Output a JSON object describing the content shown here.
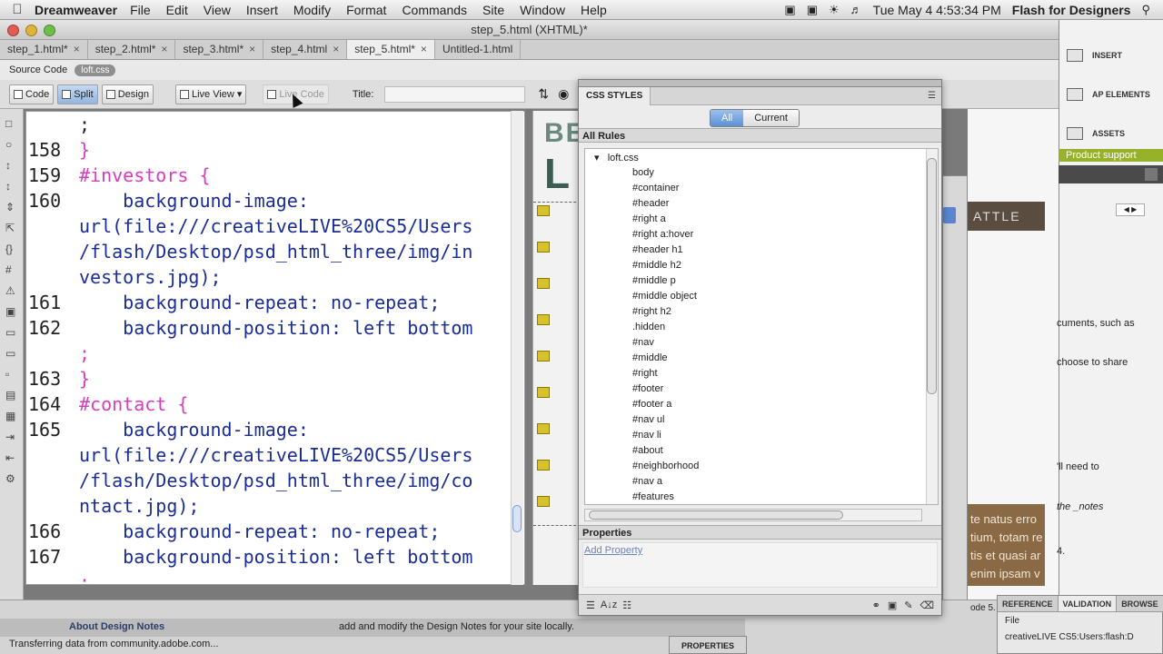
{
  "menubar": {
    "app_name": "Dreamweaver",
    "items": [
      "File",
      "Edit",
      "View",
      "Insert",
      "Modify",
      "Format",
      "Commands",
      "Site",
      "Window",
      "Help"
    ],
    "clock": "Tue May 4  4:53:34 PM",
    "workspace": "Flash for Designers"
  },
  "window": {
    "title": "step_5.html (XHTML)*",
    "tabs": [
      "step_1.html*",
      "step_2.html*",
      "step_3.html*",
      "step_4.html",
      "step_5.html*",
      "Untitled-1.html"
    ],
    "active_tab": 4
  },
  "related_files": {
    "source": "Source Code",
    "file": "loft.css"
  },
  "toolbar": {
    "code": "Code",
    "split": "Split",
    "design": "Design",
    "live_view": "Live View",
    "live_code": "Live Code",
    "title_label": "Title:"
  },
  "code": [
    {
      "num": "",
      "text": ";"
    },
    {
      "num": "158",
      "text": "}"
    },
    {
      "num": "159",
      "text": "#investors {"
    },
    {
      "num": "160",
      "text": "    background-image:"
    },
    {
      "num": "",
      "text": "url(file:///creativeLIVE%20CS5/Users"
    },
    {
      "num": "",
      "text": "/flash/Desktop/psd_html_three/img/in"
    },
    {
      "num": "",
      "text": "vestors.jpg);"
    },
    {
      "num": "161",
      "text": "    background-repeat: no-repeat;"
    },
    {
      "num": "162",
      "text": "    background-position: left bottom"
    },
    {
      "num": "",
      "text": ";"
    },
    {
      "num": "163",
      "text": "}"
    },
    {
      "num": "164",
      "text": "#contact {"
    },
    {
      "num": "165",
      "text": "    background-image:"
    },
    {
      "num": "",
      "text": "url(file:///creativeLIVE%20CS5/Users"
    },
    {
      "num": "",
      "text": "/flash/Desktop/psd_html_three/img/co"
    },
    {
      "num": "",
      "text": "ntact.jpg);"
    },
    {
      "num": "166",
      "text": "    background-repeat: no-repeat;"
    },
    {
      "num": "167",
      "text": "    background-position: left bottom"
    },
    {
      "num": "",
      "text": ";"
    }
  ],
  "design_view": {
    "letters1": "BE",
    "letters2": "L"
  },
  "css_panel": {
    "title": "CSS STYLES",
    "all": "All",
    "current": "Current",
    "all_rules": "All Rules",
    "stylesheet": "loft.css",
    "rules": [
      "body",
      "#container",
      "#header",
      "#right a",
      "#right a:hover",
      "#header h1",
      "#middle h2",
      "#middle p",
      "#middle object",
      "#right h2",
      ".hidden",
      "#nav",
      "#middle",
      "#right",
      "#footer",
      "#footer a",
      "#nav ul",
      "#nav li",
      "#about",
      "#neighborhood",
      "#nav a",
      "#features"
    ],
    "properties": "Properties",
    "add_property": "Add Property",
    "footer_sort": "A↓z"
  },
  "design_bg": {
    "banner": "ATTLE"
  },
  "dock": {
    "insert": "INSERT",
    "ap_elements": "AP ELEMENTS",
    "assets": "ASSETS",
    "product_support": "Product support",
    "text1": "cuments, such as",
    "text2": "choose to share",
    "text3": "'ll need to",
    "text4": "the _notes",
    "text5": "4."
  },
  "lorem": [
    "te natus erro",
    "tium, totam re",
    "tis et quasi ar",
    "enim ipsam v"
  ],
  "bottom_panel": {
    "tabs": [
      "REFERENCE",
      "VALIDATION",
      "BROWSE"
    ],
    "file_label": "File",
    "file_path": "creativeLIVE CS5:Users:flash:D",
    "ode": "ode 5."
  },
  "status": {
    "design_notes": "About Design Notes",
    "design_notes_desc": "add and modify the Design Notes for your site locally.",
    "transfer": "Transferring data from community.adobe.com..."
  },
  "properties_tab": "PROPERTIES",
  "colors": {
    "selector": "#d63dbf",
    "property": "#1a2c96",
    "accent": "#5a90d8",
    "green": "#97b12b"
  }
}
